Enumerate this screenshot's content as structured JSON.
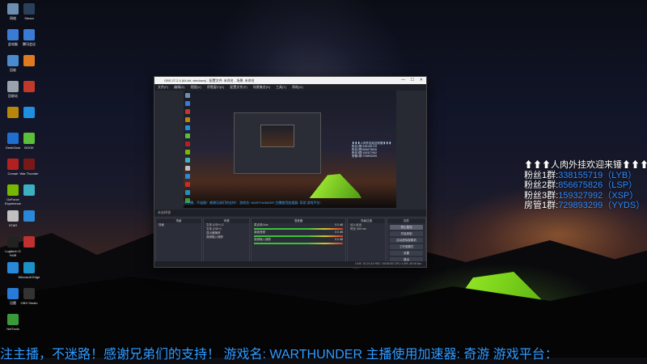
{
  "desktop": {
    "icons": [
      {
        "label": "网络",
        "color": "#6a8fb0"
      },
      {
        "label": "Steam",
        "color": "#2a3f5a"
      },
      {
        "label": "此电脑",
        "color": "#3a7bd5"
      },
      {
        "label": "腾讯会议",
        "color": "#3a7bd5"
      },
      {
        "label": "回收",
        "color": "#4a8bd0"
      },
      {
        "label": "",
        "color": "#e07a20"
      },
      {
        "label": "回收站",
        "color": "#9aa3ad"
      },
      {
        "label": "",
        "color": "#c0392b"
      },
      {
        "label": "",
        "color": "#b8860b"
      },
      {
        "label": "",
        "color": "#1f8fe0"
      },
      {
        "label": "GeekGear",
        "color": "#1f6fd0"
      },
      {
        "label": "BOOK",
        "color": "#5bbf3a"
      },
      {
        "label": "Corsair",
        "color": "#b32020"
      },
      {
        "label": "War Thunder",
        "color": "#7a1818"
      },
      {
        "label": "GeForce Experience",
        "color": "#76b900"
      },
      {
        "label": "",
        "color": "#3ab0c0"
      },
      {
        "label": "STAR",
        "color": "#c0c0c0"
      },
      {
        "label": "",
        "color": "#2a88d8"
      },
      {
        "label": "Logitech G HUB",
        "color": "#222"
      },
      {
        "label": "",
        "color": "#c03030"
      },
      {
        "label": "",
        "color": "#2a88d8"
      },
      {
        "label": "Microsoft Edge",
        "color": "#1e90c8"
      },
      {
        "label": "迅雷",
        "color": "#2a7ad8"
      },
      {
        "label": "OBS Studio",
        "color": "#333"
      },
      {
        "label": "NetTools",
        "color": "#3a9a3a"
      }
    ]
  },
  "obs": {
    "title": "OBS 27.2.4 (64-bit, windows) - 配置文件: 未命名 - 场景: 未命名",
    "menu": [
      "文件(F)",
      "编辑(E)",
      "视图(V)",
      "停靠窗口(D)",
      "配置文件(P)",
      "场景集合(S)",
      "工具(T)",
      "帮助(H)"
    ],
    "status_row": "未选择源",
    "docks": {
      "scenes": {
        "header": "场景",
        "items": [
          "场景"
        ]
      },
      "sources": {
        "header": "来源",
        "items": [
          "文本 (GDI+) 2",
          "文本 (GDI+)",
          "显示器捕获",
          "音频输入捕获"
        ]
      },
      "mixer": {
        "header": "混音器",
        "channels": [
          {
            "name": "麦克风/Aux",
            "db": "0.0 dB"
          },
          {
            "name": "桌面音频",
            "db": "0.0 dB"
          },
          {
            "name": "音频输入捕获",
            "db": "0.0 dB"
          }
        ]
      },
      "transitions": {
        "header": "场景过渡",
        "type": "淡入淡出",
        "duration_label": "时长",
        "duration": "300 ms"
      },
      "controls": {
        "header": "控件",
        "buttons": [
          "停止推流",
          "开始录制",
          "启动虚拟摄像机",
          "工作室模式",
          "设置",
          "退出"
        ]
      }
    },
    "status_bar": "LIVE: 01:21:41   REC: 00:00:00   CPU: 4.5%, 60.00 fps"
  },
  "overlay": {
    "header": "⬆⬆⬆人肉外挂欢迎来锤⬆⬆⬆",
    "groups": [
      {
        "label": "粉丝1群:",
        "number": "338155719",
        "tag": "（LYB）"
      },
      {
        "label": "粉丝2群:",
        "number": "856675826",
        "tag": "（LSP）"
      },
      {
        "label": "粉丝3群:",
        "number": "159327992",
        "tag": "（XSP）"
      },
      {
        "label": "房管1群:",
        "number": "729893299",
        "tag": "（YYDS）"
      }
    ],
    "marquee": "注主播，不迷路！感谢兄弟们的支持！  游戏名: WARTHUNDER  主播使用加速器: 奇游    游戏平台："
  },
  "colors": {
    "accent_blue": "#2f9dff",
    "tent_green": "#8fe626",
    "obs_bg": "#272a33"
  }
}
